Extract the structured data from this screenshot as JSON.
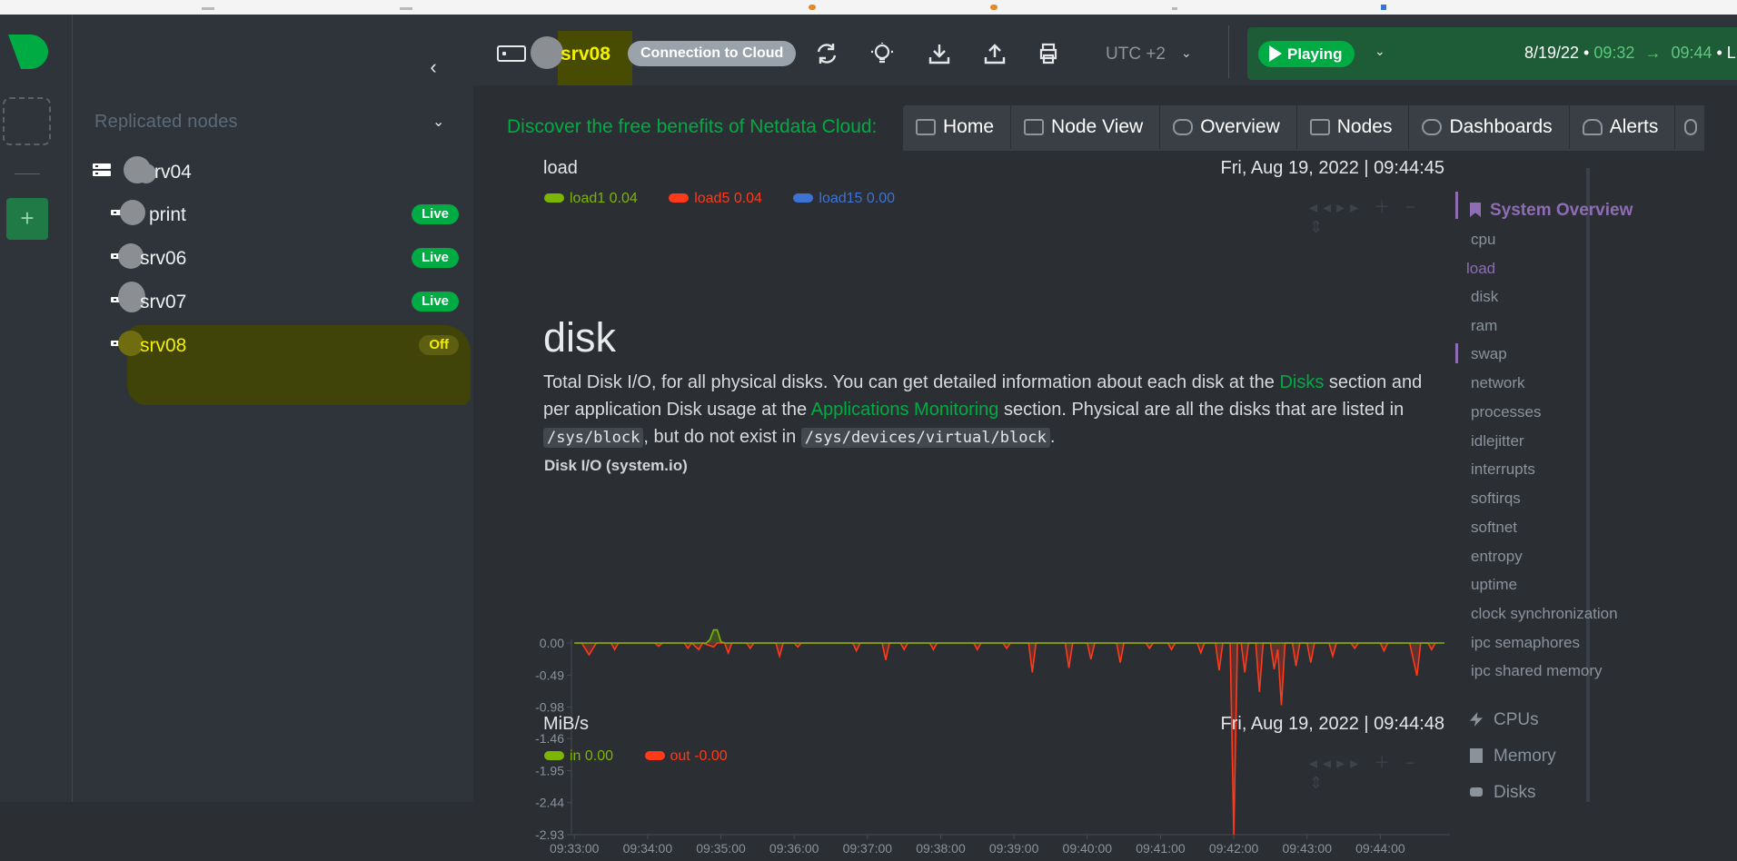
{
  "sidebar": {
    "heading": "Replicated nodes",
    "nodes": [
      {
        "name": "rv04",
        "badge": ""
      },
      {
        "name": "print",
        "badge": "Live"
      },
      {
        "name": "srv06",
        "badge": "Live"
      },
      {
        "name": "srv07",
        "badge": "Live"
      },
      {
        "name": "srv08",
        "badge": "Off"
      }
    ]
  },
  "header": {
    "host": "srv08",
    "cloud_pill": "Connection to Cloud",
    "timezone": "UTC +2",
    "play_label": "Playing",
    "range_date": "8/19/22 •",
    "range_from": "09:32",
    "range_arrow": "→",
    "range_to": "09:44",
    "range_tail": " • L"
  },
  "cloudnav": {
    "promo": "Discover the free benefits of Netdata Cloud:",
    "tabs": [
      "Home",
      "Node View",
      "Overview",
      "Nodes",
      "Dashboards",
      "Alerts"
    ]
  },
  "load_chart": {
    "units": "load",
    "timestamp": "Fri, Aug 19, 2022 | 09:44:45",
    "legend": [
      {
        "name": "load1",
        "value": "0.04",
        "color": "#7cb600"
      },
      {
        "name": "load5",
        "value": "0.04",
        "color": "#ff3a1a"
      },
      {
        "name": "load15",
        "value": "0.00",
        "color": "#3d74d4"
      }
    ]
  },
  "disk_section": {
    "title": "disk",
    "desc_1": "Total Disk I/O, for all physical disks. You can get detailed information about each disk at the ",
    "desc_link1": "Disks",
    "desc_2": " section and per application Disk usage at the ",
    "desc_link2": "Applications Monitoring",
    "desc_3": " section. Physical are all the disks that are listed in ",
    "desc_code1": "/sys/block",
    "desc_4": ", but do not exist in ",
    "desc_code2": "/sys/devices/virtual/block",
    "desc_5": "."
  },
  "chart_data": {
    "type": "line",
    "title": "Disk I/O (system.io)",
    "ylabel": "MiB/s",
    "timestamp": "Fri, Aug 19, 2022 | 09:44:48",
    "ylim": [
      -2.93,
      0.0
    ],
    "yticks": [
      "0.00",
      "-0.49",
      "-0.98",
      "-1.46",
      "-1.95",
      "-2.44",
      "-2.93"
    ],
    "xticks": [
      "09:33:00",
      "09:34:00",
      "09:35:00",
      "09:36:00",
      "09:37:00",
      "09:38:00",
      "09:39:00",
      "09:40:00",
      "09:41:00",
      "09:42:00",
      "09:43:00",
      "09:44:00"
    ],
    "series": [
      {
        "name": "in",
        "value": "0.00",
        "color": "#7cb600",
        "points": [
          [
            0,
            0
          ],
          [
            1.8,
            0
          ],
          [
            1.85,
            0.05
          ],
          [
            1.9,
            0.2
          ],
          [
            1.95,
            0.2
          ],
          [
            2.0,
            0.02
          ],
          [
            2.05,
            0
          ],
          [
            12,
            0
          ]
        ]
      },
      {
        "name": "out",
        "value": "-0.00",
        "color": "#ff3a1a",
        "points": [
          [
            0,
            0
          ],
          [
            0.1,
            0
          ],
          [
            0.2,
            -0.18
          ],
          [
            0.3,
            0
          ],
          [
            0.5,
            0
          ],
          [
            0.55,
            -0.1
          ],
          [
            0.6,
            0
          ],
          [
            1.1,
            0
          ],
          [
            1.15,
            -0.05
          ],
          [
            1.2,
            0
          ],
          [
            1.5,
            0
          ],
          [
            1.55,
            -0.08
          ],
          [
            1.6,
            0
          ],
          [
            1.7,
            -0.1
          ],
          [
            1.75,
            0
          ],
          [
            1.9,
            -0.06
          ],
          [
            1.95,
            0
          ],
          [
            2.05,
            0
          ],
          [
            2.1,
            -0.15
          ],
          [
            2.15,
            0
          ],
          [
            2.35,
            0
          ],
          [
            2.4,
            -0.08
          ],
          [
            2.45,
            0
          ],
          [
            2.75,
            0
          ],
          [
            2.8,
            -0.2
          ],
          [
            2.85,
            0
          ],
          [
            3.0,
            0
          ],
          [
            3.05,
            -0.06
          ],
          [
            3.1,
            0
          ],
          [
            3.8,
            0
          ],
          [
            3.85,
            -0.12
          ],
          [
            3.9,
            0
          ],
          [
            4.2,
            0
          ],
          [
            4.25,
            -0.26
          ],
          [
            4.3,
            0
          ],
          [
            4.45,
            0
          ],
          [
            4.5,
            -0.1
          ],
          [
            4.55,
            0
          ],
          [
            4.85,
            0
          ],
          [
            4.9,
            -0.1
          ],
          [
            4.95,
            0
          ],
          [
            5.45,
            0
          ],
          [
            5.5,
            -0.1
          ],
          [
            5.55,
            0
          ],
          [
            5.85,
            0
          ],
          [
            5.9,
            -0.08
          ],
          [
            5.95,
            0
          ],
          [
            6.2,
            0
          ],
          [
            6.25,
            -0.45
          ],
          [
            6.3,
            0
          ],
          [
            6.7,
            0
          ],
          [
            6.75,
            -0.38
          ],
          [
            6.8,
            0
          ],
          [
            7.0,
            0
          ],
          [
            7.05,
            -0.25
          ],
          [
            7.1,
            0
          ],
          [
            7.4,
            0
          ],
          [
            7.45,
            -0.3
          ],
          [
            7.5,
            0
          ],
          [
            7.8,
            0
          ],
          [
            7.85,
            -0.08
          ],
          [
            7.9,
            0
          ],
          [
            8.1,
            0
          ],
          [
            8.15,
            -0.1
          ],
          [
            8.2,
            0
          ],
          [
            8.5,
            0
          ],
          [
            8.55,
            -0.15
          ],
          [
            8.6,
            0
          ],
          [
            8.75,
            0
          ],
          [
            8.8,
            -0.42
          ],
          [
            8.85,
            0
          ],
          [
            8.95,
            0
          ],
          [
            9.0,
            -2.93
          ],
          [
            9.05,
            0
          ],
          [
            9.1,
            0
          ],
          [
            9.15,
            -0.45
          ],
          [
            9.2,
            0
          ],
          [
            9.3,
            0
          ],
          [
            9.35,
            -0.75
          ],
          [
            9.4,
            0
          ],
          [
            9.5,
            0
          ],
          [
            9.55,
            -0.4
          ],
          [
            9.6,
            -0.1
          ],
          [
            9.65,
            -0.95
          ],
          [
            9.7,
            0
          ],
          [
            9.8,
            0
          ],
          [
            9.85,
            -0.35
          ],
          [
            9.9,
            0
          ],
          [
            10.0,
            0
          ],
          [
            10.05,
            -0.3
          ],
          [
            10.1,
            0
          ],
          [
            10.3,
            0
          ],
          [
            10.35,
            -0.2
          ],
          [
            10.4,
            0
          ],
          [
            10.6,
            0
          ],
          [
            10.65,
            -0.08
          ],
          [
            10.7,
            0
          ],
          [
            11.0,
            0
          ],
          [
            11.05,
            -0.12
          ],
          [
            11.1,
            0
          ],
          [
            11.4,
            0
          ],
          [
            11.5,
            -0.5
          ],
          [
            11.55,
            0
          ],
          [
            11.65,
            0
          ],
          [
            11.7,
            -0.1
          ],
          [
            11.75,
            0
          ]
        ]
      }
    ]
  },
  "disk_legend": [
    {
      "name": "in",
      "value": "0.00",
      "color": "#7cb600"
    },
    {
      "name": "out",
      "value": "-0.00",
      "color": "#ff3a1a"
    }
  ],
  "toc": {
    "title": "System Overview",
    "items": [
      "cpu",
      "load",
      "disk",
      "ram",
      "swap",
      "network",
      "processes",
      "idlejitter",
      "interrupts",
      "softirqs",
      "softnet",
      "entropy",
      "uptime",
      "clock synchronization",
      "ipc semaphores",
      "ipc shared memory"
    ],
    "active": "load",
    "groups": [
      "CPUs",
      "Memory",
      "Disks"
    ]
  }
}
